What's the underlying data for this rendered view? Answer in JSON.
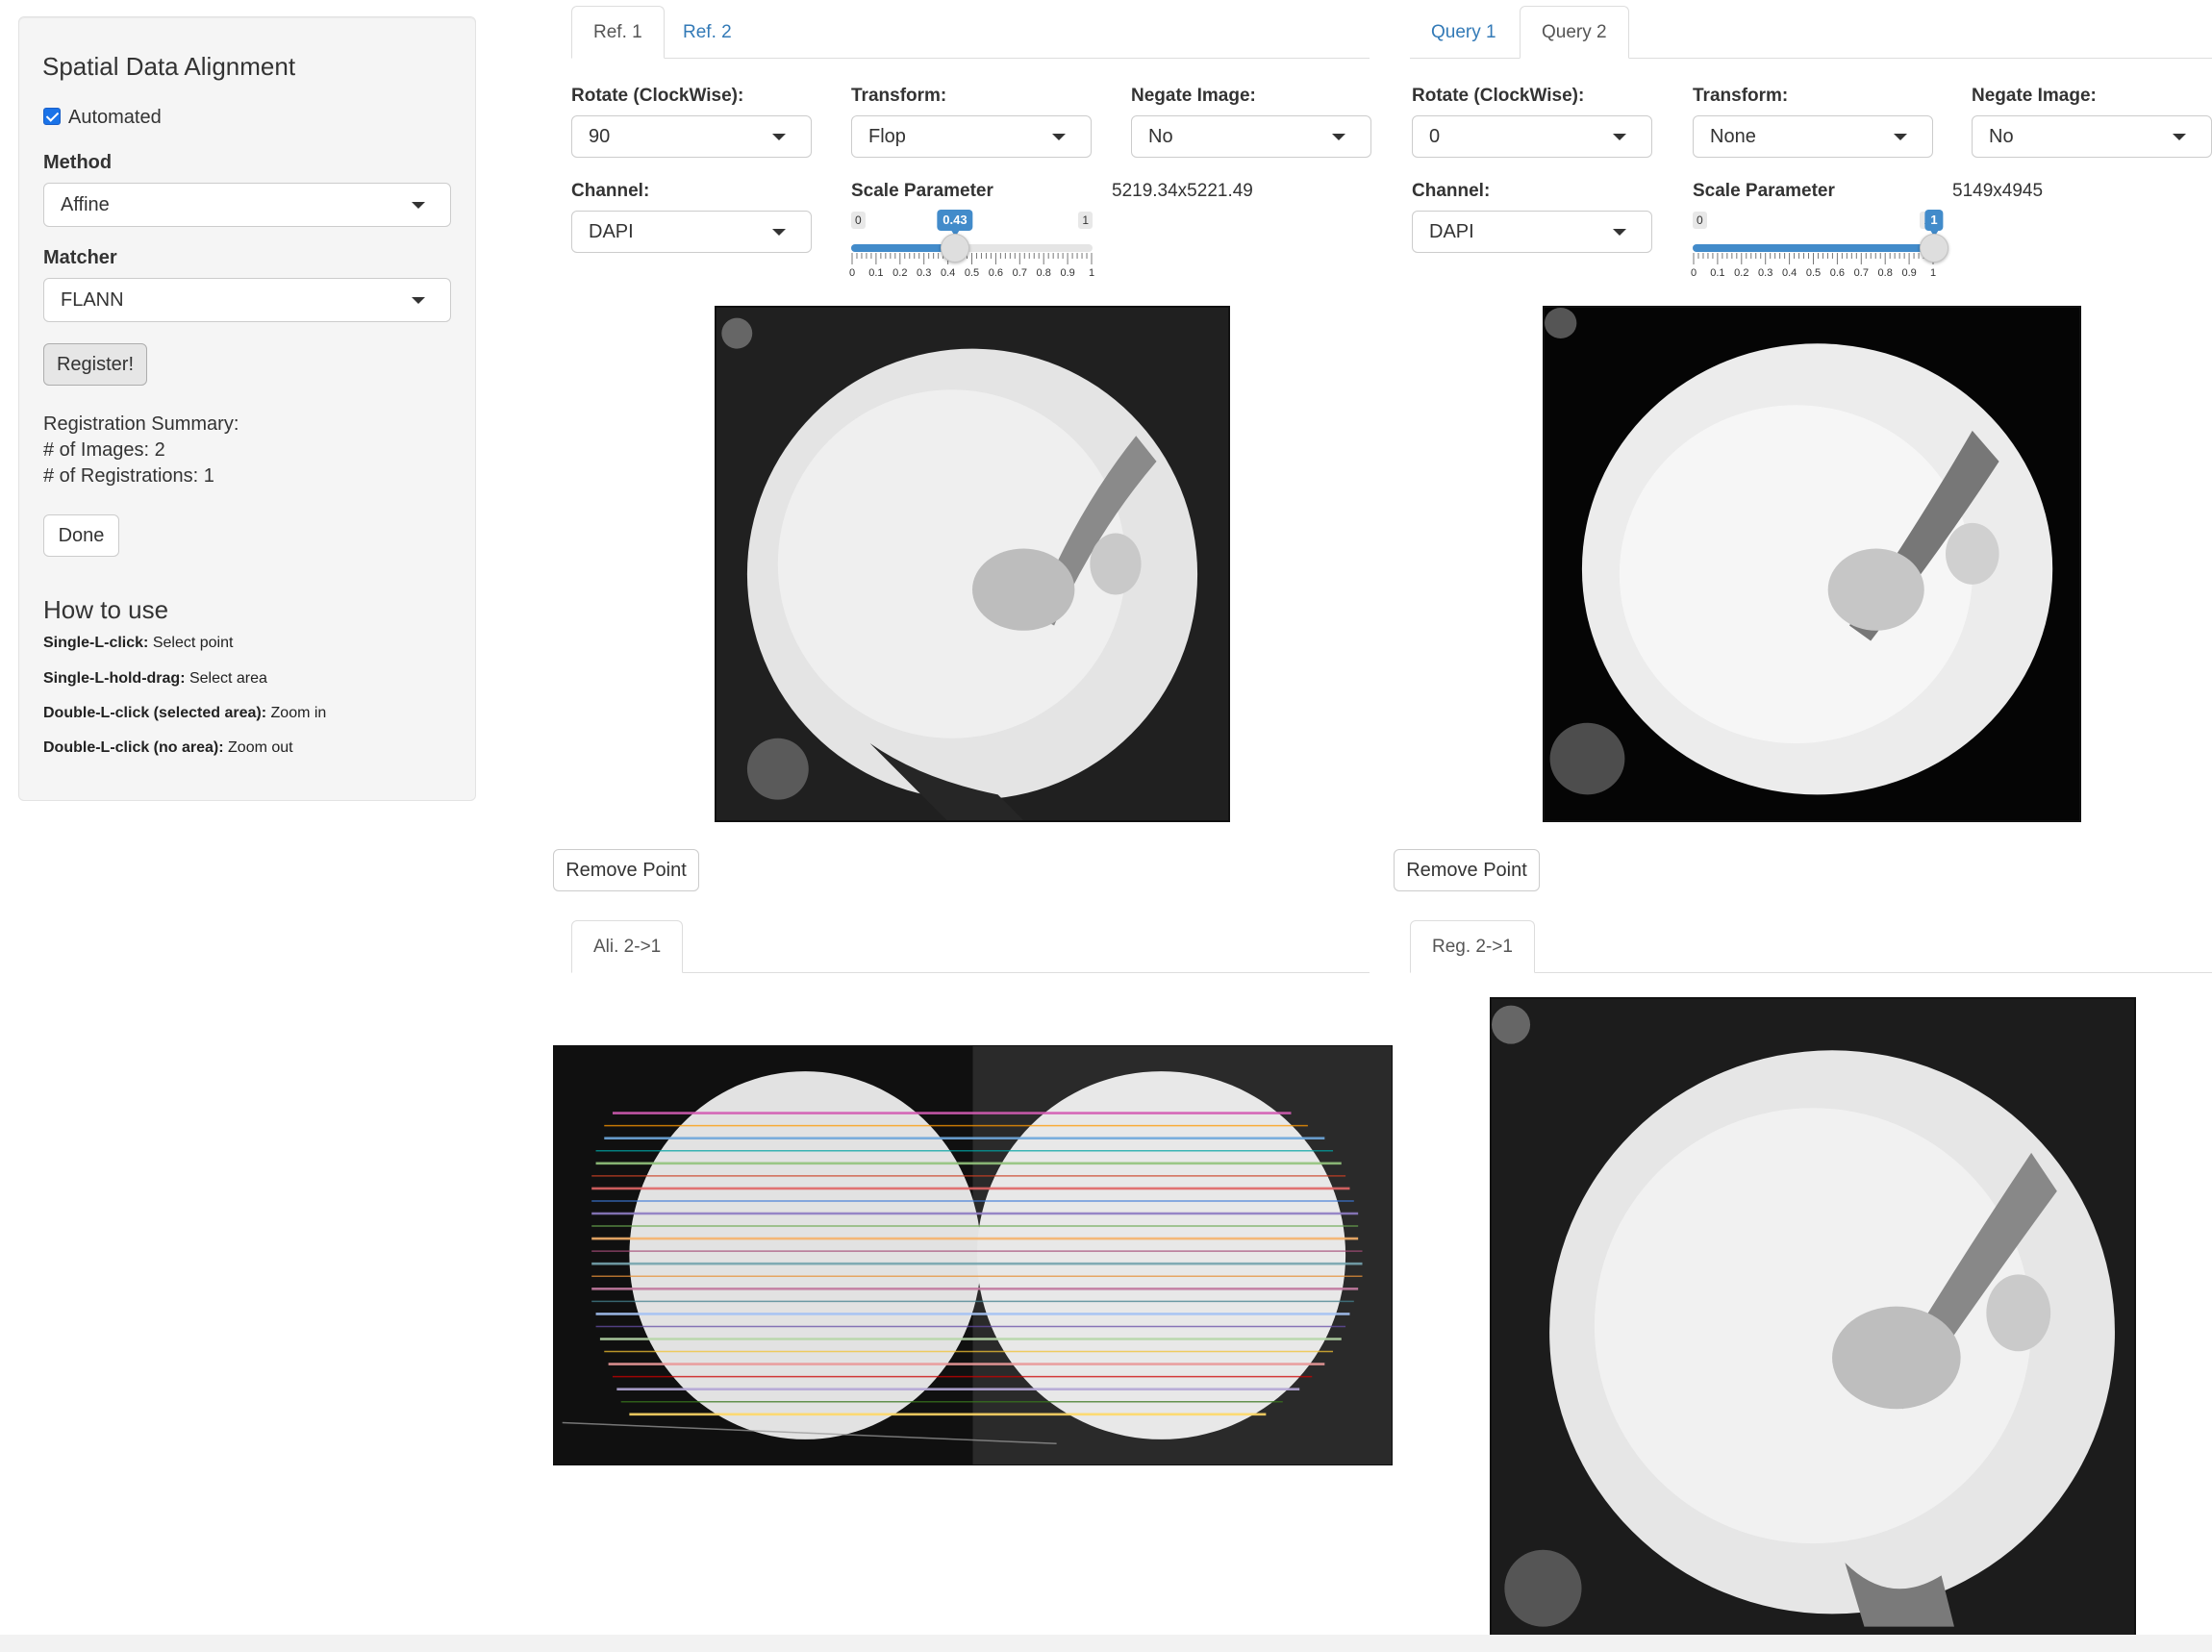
{
  "sidebar": {
    "title": "Spatial Data Alignment",
    "automated": {
      "label": "Automated",
      "checked": true
    },
    "method": {
      "label": "Method",
      "value": "Affine"
    },
    "matcher": {
      "label": "Matcher",
      "value": "FLANN"
    },
    "register_label": "Register!",
    "summary": {
      "heading": "Registration Summary:",
      "images": "# of Images: 2",
      "registrations": "# of Registrations: 1"
    },
    "done_label": "Done",
    "how_to": {
      "title": "How to use",
      "items": [
        {
          "key": "Single-L-click:",
          "text": "Select point"
        },
        {
          "key": "Single-L-hold-drag:",
          "text": "Select area"
        },
        {
          "key": "Double-L-click (selected area):",
          "text": "Zoom in"
        },
        {
          "key": "Double-L-click (no area):",
          "text": "Zoom out"
        }
      ]
    }
  },
  "ref_panel": {
    "tabs": [
      {
        "label": "Ref. 1",
        "active": true
      },
      {
        "label": "Ref. 2",
        "active": false
      }
    ],
    "rotate": {
      "label": "Rotate (ClockWise):",
      "value": "90"
    },
    "transform": {
      "label": "Transform:",
      "value": "Flop"
    },
    "negate": {
      "label": "Negate Image:",
      "value": "No"
    },
    "channel": {
      "label": "Channel:",
      "value": "DAPI"
    },
    "scale": {
      "label": "Scale Parameter",
      "min": "0",
      "max": "1",
      "value": 0.43,
      "value_label": "0.43"
    },
    "dimensions": "5219.34x5221.49",
    "remove_label": "Remove Point"
  },
  "query_panel": {
    "tabs": [
      {
        "label": "Query 1",
        "active": false
      },
      {
        "label": "Query 2",
        "active": true
      }
    ],
    "rotate": {
      "label": "Rotate (ClockWise):",
      "value": "0"
    },
    "transform": {
      "label": "Transform:",
      "value": "None"
    },
    "negate": {
      "label": "Negate Image:",
      "value": "No"
    },
    "channel": {
      "label": "Channel:",
      "value": "DAPI"
    },
    "scale": {
      "label": "Scale Parameter",
      "min": "0",
      "max": "1",
      "value": 1,
      "value_label": "1"
    },
    "dimensions": "5149x4945",
    "remove_label": "Remove Point"
  },
  "slider_grid": [
    "0",
    "0.1",
    "0.2",
    "0.3",
    "0.4",
    "0.5",
    "0.6",
    "0.7",
    "0.8",
    "0.9",
    "1"
  ],
  "alignment_tab": {
    "label": "Ali. 2->1"
  },
  "registration_tab": {
    "label": "Reg. 2->1"
  },
  "colors": {
    "link": "#337ab7",
    "slider_blue": "#428bca",
    "checkbox_blue": "#1a73e8",
    "sidebar_bg": "#f5f5f5"
  }
}
